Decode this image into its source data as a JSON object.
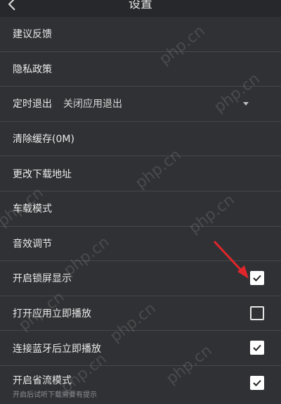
{
  "header": {
    "title": "设置"
  },
  "settings": [
    {
      "label": "建议反馈"
    },
    {
      "label": "隐私政策"
    },
    {
      "label": "定时退出",
      "value": "关闭应用退出"
    },
    {
      "label": "清除缓存(0M)"
    },
    {
      "label": "更改下载地址"
    },
    {
      "label": "车载模式"
    },
    {
      "label": "音效调节"
    },
    {
      "label": "开启锁屏显示",
      "checked": true
    },
    {
      "label": "打开应用立即播放",
      "checked": false
    },
    {
      "label": "连接蓝牙后立即播放",
      "checked": true
    },
    {
      "label": "开启省流模式",
      "subtitle": "开启后试听下载需要有提示",
      "checked": true
    }
  ],
  "watermark": "php.cn",
  "colors": {
    "background": "#2f3134",
    "divider": "#45484c",
    "arrow": "#e0262b"
  }
}
